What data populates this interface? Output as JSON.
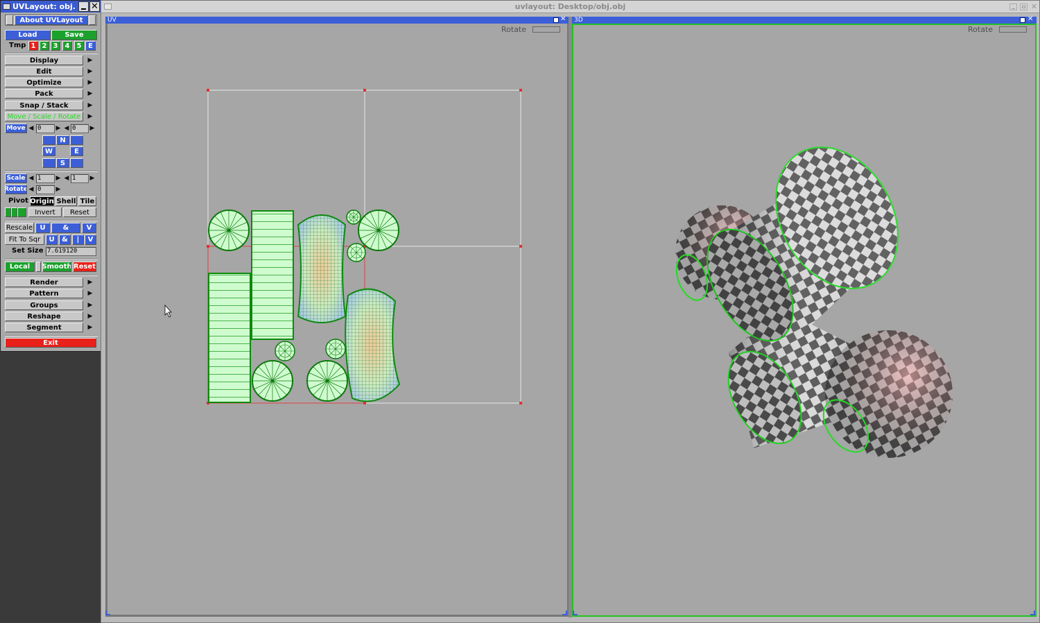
{
  "panel": {
    "title": "UVLayout: obj.",
    "about_label": "About UVLayout",
    "load_label": "Load",
    "save_label": "Save",
    "tmp_label": "Tmp",
    "tmp_slots": [
      "1",
      "2",
      "3",
      "4",
      "5",
      "E"
    ],
    "menus": [
      "Display",
      "Edit",
      "Optimize",
      "Pack",
      "Snap / Stack",
      "Move / Scale / Rotate"
    ],
    "move_label": "Move",
    "move_x": "0",
    "move_y": "0",
    "dir_n": "N",
    "dir_w": "W",
    "dir_e": "E",
    "dir_s": "S",
    "scale_label": "Scale",
    "scale_x": "1",
    "scale_y": "1",
    "rotate_label": "Rotate",
    "rotate_value": "0",
    "pivot_label": "Pivot",
    "pivot_origin": "Origin",
    "pivot_shell": "Shell",
    "pivot_tile": "Tile",
    "invert_label": "Invert",
    "reset_label": "Reset",
    "rescale_label": "Rescale",
    "u_label": "U",
    "amp_label": "&",
    "v_label": "V",
    "fit_label": "Fit To Sqr",
    "i_label": "|",
    "setsize_label": "Set Size",
    "setsize_value": "7.619120",
    "local_label": "Local",
    "smooth_label": "Smooth",
    "reset_red_label": "Reset",
    "menus2": [
      "Render",
      "Pattern",
      "Groups",
      "Reshape",
      "Segment"
    ],
    "exit_label": "Exit"
  },
  "main_window": {
    "title": "uvlayout: Desktop/obj.obj"
  },
  "uv_view": {
    "title": "UV",
    "rotate_label": "Rotate"
  },
  "view3d": {
    "title": "3D",
    "rotate_label": "Rotate"
  },
  "colors": {
    "accent_blue": "#3c5fd7",
    "button_green": "#1ba12c",
    "alert_red": "#e8211b",
    "viewport_gray": "#a6a6a6",
    "menu_highlight_green": "#22dd22"
  }
}
